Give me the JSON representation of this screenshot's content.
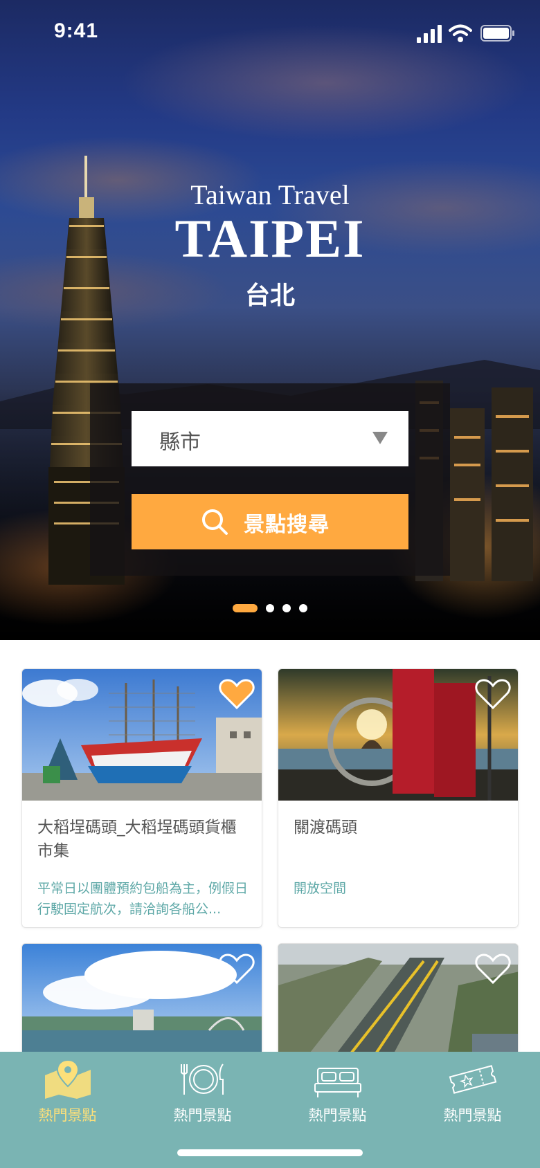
{
  "status_bar": {
    "time": "9:41"
  },
  "hero": {
    "subtitle": "Taiwan Travel",
    "title": "TAIPEI",
    "title_zh": "台北"
  },
  "search": {
    "select_value": "縣市",
    "button_label": "景點搜尋"
  },
  "carousel": {
    "total": 4,
    "active_index": 0
  },
  "colors": {
    "accent": "#ffa940",
    "teal": "#7ab4b3",
    "desc_text": "#5ea8a7",
    "active_tab": "#fde07a"
  },
  "cards": [
    {
      "title": "大稻埕碼頭_大稻埕碼頭貨櫃市集",
      "desc": "平常日以團體預約包船為主，例假日行駛固定航次，請洽詢各船公...",
      "favorited": true
    },
    {
      "title": "關渡碼頭",
      "desc": "開放空間",
      "favorited": false
    },
    {
      "title": "",
      "desc": "",
      "favorited": false
    },
    {
      "title": "",
      "desc": "",
      "favorited": false
    }
  ],
  "tabs": [
    {
      "label": "熱門景點",
      "icon": "map-pin-icon",
      "active": true
    },
    {
      "label": "熱門景點",
      "icon": "dining-icon",
      "active": false
    },
    {
      "label": "熱門景點",
      "icon": "bed-icon",
      "active": false
    },
    {
      "label": "熱門景點",
      "icon": "ticket-icon",
      "active": false
    }
  ]
}
